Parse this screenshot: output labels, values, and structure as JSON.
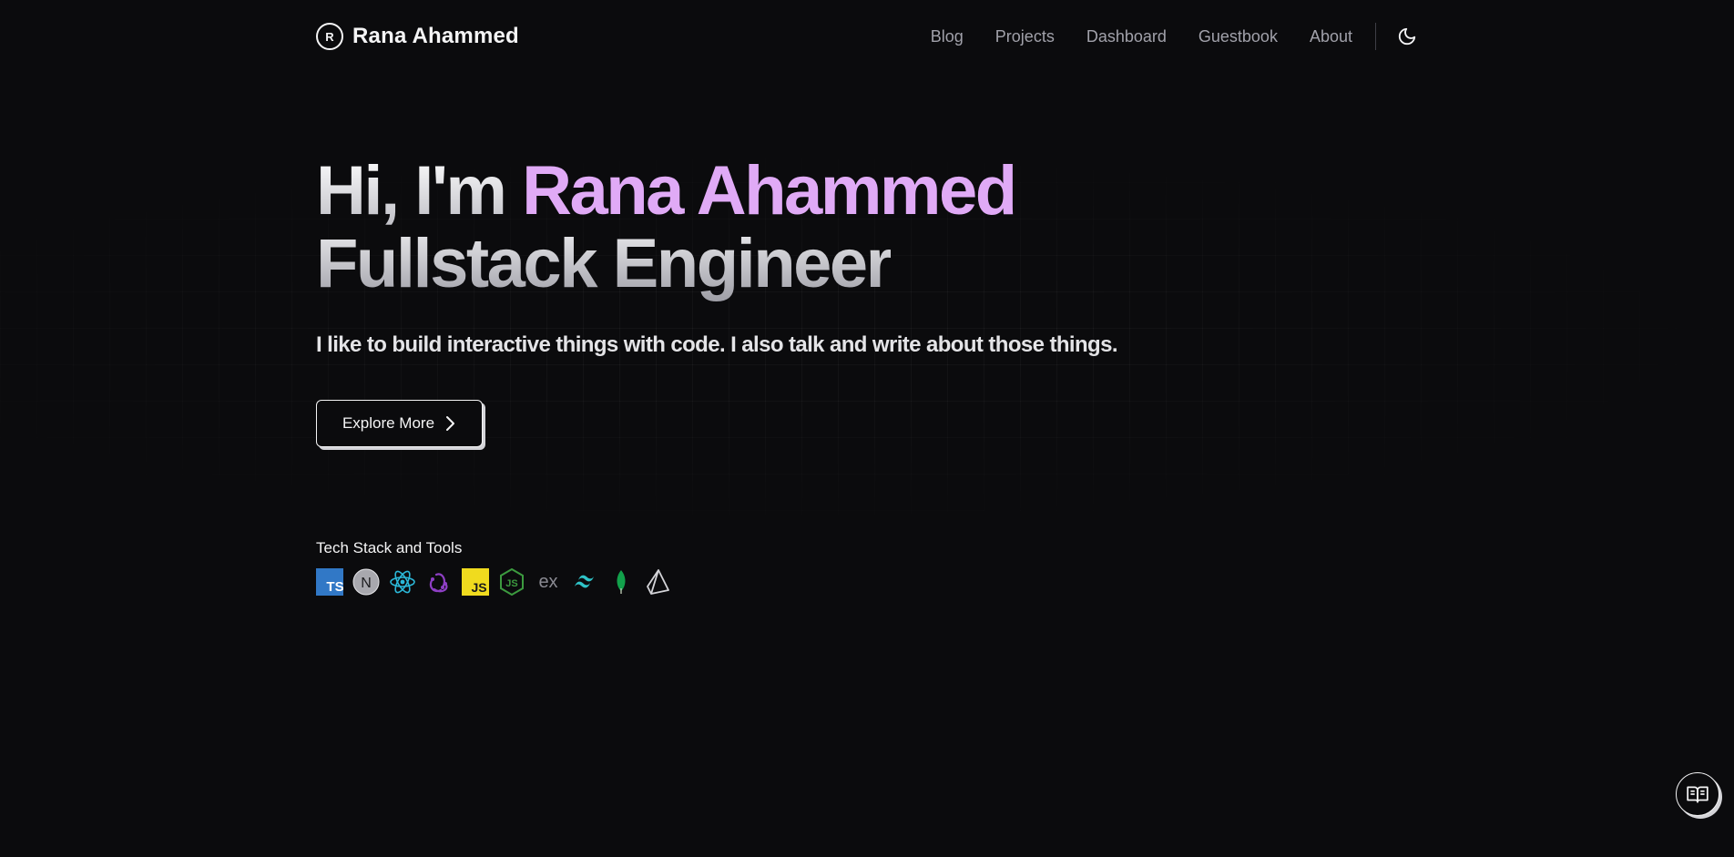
{
  "header": {
    "brand_initial": "R",
    "brand_name": "Rana Ahammed",
    "nav": [
      "Blog",
      "Projects",
      "Dashboard",
      "Guestbook",
      "About"
    ],
    "theme_icon": "moon-icon"
  },
  "hero": {
    "greeting": "Hi, I'm ",
    "name": "Rana Ahammed",
    "role": "Fullstack Engineer",
    "tagline": "I like to build interactive things with code. I also talk and write about those things.",
    "cta_label": "Explore More",
    "cta_icon": "chevron-right-icon"
  },
  "stack": {
    "title": "Tech Stack and Tools",
    "icons": [
      {
        "name": "typescript-icon",
        "label": "TS"
      },
      {
        "name": "nextjs-icon",
        "label": "N"
      },
      {
        "name": "react-icon"
      },
      {
        "name": "redux-icon"
      },
      {
        "name": "javascript-icon",
        "label": "JS"
      },
      {
        "name": "nodejs-icon",
        "label": "JS"
      },
      {
        "name": "express-icon",
        "label": "ex"
      },
      {
        "name": "tailwind-icon"
      },
      {
        "name": "mongodb-icon"
      },
      {
        "name": "prisma-icon"
      }
    ]
  },
  "floating": {
    "reader_icon": "book-open-icon"
  },
  "colors": {
    "background": "#0b0b0d",
    "accent": "#e0aaf6",
    "muted": "#a1a1aa"
  }
}
